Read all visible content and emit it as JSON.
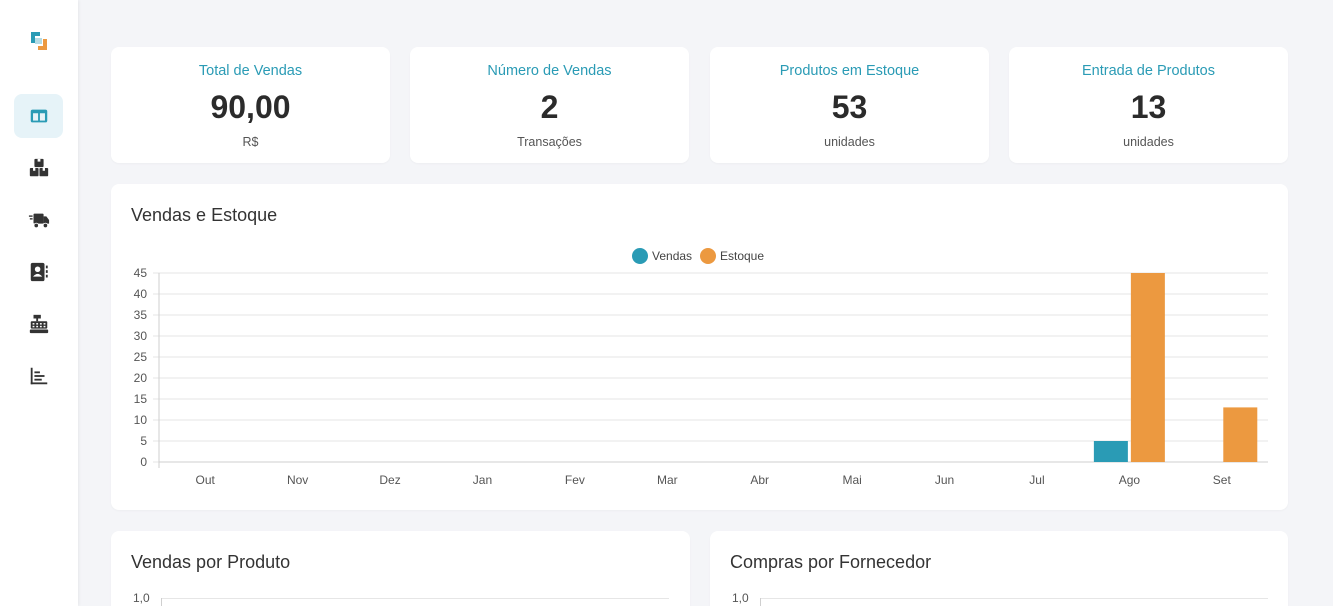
{
  "sidebar": {
    "logo": "app-logo",
    "items": [
      {
        "icon": "dashboard-icon",
        "active": true
      },
      {
        "icon": "boxes-icon",
        "active": false
      },
      {
        "icon": "truck-icon",
        "active": false
      },
      {
        "icon": "contacts-icon",
        "active": false
      },
      {
        "icon": "cash-register-icon",
        "active": false
      },
      {
        "icon": "bar-chart-icon",
        "active": false
      }
    ]
  },
  "kpis": [
    {
      "title": "Total de Vendas",
      "value": "90,00",
      "unit": "R$"
    },
    {
      "title": "Número de Vendas",
      "value": "2",
      "unit": "Transações"
    },
    {
      "title": "Produtos em Estoque",
      "value": "53",
      "unit": "unidades"
    },
    {
      "title": "Entrada de Produtos",
      "value": "13",
      "unit": "unidades"
    }
  ],
  "main_card": {
    "title": "Vendas e Estoque"
  },
  "sales_card": {
    "title": "Vendas por Produto",
    "ytick": "1,0"
  },
  "purchases_card": {
    "title": "Compras por Fornecedor",
    "ytick": "1,0"
  },
  "colors": {
    "vendas": "#2a9bb5",
    "estoque": "#ec9940",
    "accent": "#2a9bb5"
  },
  "chart_data": {
    "type": "bar",
    "categories": [
      "Out",
      "Nov",
      "Dez",
      "Jan",
      "Fev",
      "Mar",
      "Abr",
      "Mai",
      "Jun",
      "Jul",
      "Ago",
      "Set"
    ],
    "series": [
      {
        "name": "Vendas",
        "values": [
          0,
          0,
          0,
          0,
          0,
          0,
          0,
          0,
          0,
          0,
          5,
          0
        ]
      },
      {
        "name": "Estoque",
        "values": [
          0,
          0,
          0,
          0,
          0,
          0,
          0,
          0,
          0,
          0,
          45,
          13
        ]
      }
    ],
    "yticks": [
      "0",
      "5",
      "10",
      "15",
      "20",
      "25",
      "30",
      "35",
      "40",
      "45"
    ],
    "ylim": [
      0,
      45
    ],
    "legend": "top-center",
    "grid": true
  }
}
